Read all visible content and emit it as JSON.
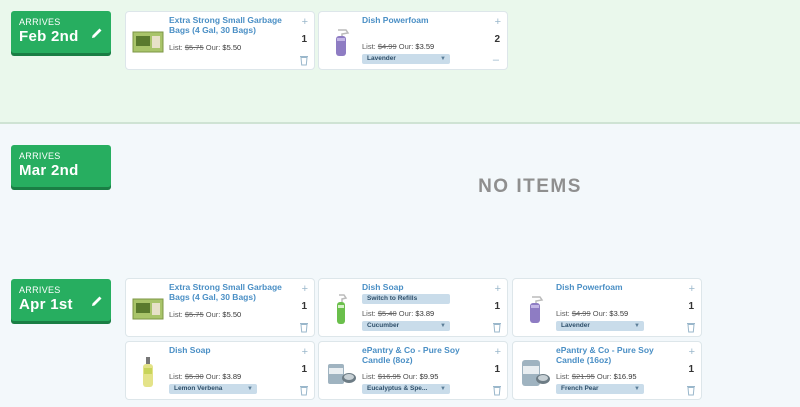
{
  "shipments": [
    {
      "arrives_label": "ARRIVES",
      "date": "Feb 2nd",
      "items": [
        {
          "title": "Extra Strong Small Garbage Bags (4 Gal, 30 Bags)",
          "list_label": "List:",
          "list_price": "$5.75",
          "our_label": "Our:",
          "our_price": "$5.50",
          "qty": "1",
          "variant": "",
          "control": "trash",
          "icon": "garbage-bags-product-image"
        },
        {
          "title": "Dish Powerfoam",
          "list_label": "List:",
          "list_price": "$4.99",
          "our_label": "Our:",
          "our_price": "$3.59",
          "qty": "2",
          "variant": "Lavender",
          "control": "minus",
          "icon": "dish-powerfoam-product-image"
        }
      ]
    },
    {
      "arrives_label": "ARRIVES",
      "date": "Mar 2nd",
      "empty_text": "NO ITEMS",
      "items": []
    },
    {
      "arrives_label": "ARRIVES",
      "date": "Apr 1st",
      "items": [
        {
          "title": "Extra Strong Small Garbage Bags (4 Gal, 30 Bags)",
          "list_label": "List:",
          "list_price": "$5.75",
          "our_label": "Our:",
          "our_price": "$5.50",
          "qty": "1",
          "variant": "",
          "control": "trash",
          "icon": "garbage-bags-product-image"
        },
        {
          "title": "Dish Soap",
          "refill_label": "Switch to Refills",
          "list_label": "List:",
          "list_price": "$5.40",
          "our_label": "Our:",
          "our_price": "$3.89",
          "qty": "1",
          "variant": "Cucumber",
          "control": "trash",
          "icon": "dish-soap-cucumber-product-image"
        },
        {
          "title": "Dish Powerfoam",
          "list_label": "List:",
          "list_price": "$4.99",
          "our_label": "Our:",
          "our_price": "$3.59",
          "qty": "1",
          "variant": "Lavender",
          "control": "trash",
          "icon": "dish-powerfoam-product-image"
        },
        {
          "title": "Dish Soap",
          "list_label": "List:",
          "list_price": "$5.30",
          "our_label": "Our:",
          "our_price": "$3.89",
          "qty": "1",
          "variant": "Lemon Verbena",
          "control": "trash",
          "icon": "dish-soap-lemon-product-image"
        },
        {
          "title": "ePantry & Co - Pure Soy Candle (8oz)",
          "list_label": "List:",
          "list_price": "$16.95",
          "our_label": "Our:",
          "our_price": "$9.95",
          "qty": "1",
          "variant": "Eucalyptus & Spe...",
          "control": "trash",
          "icon": "soy-candle-8oz-product-image"
        },
        {
          "title": "ePantry & Co - Pure Soy Candle (16oz)",
          "list_label": "List:",
          "list_price": "$21.95",
          "our_label": "Our:",
          "our_price": "$16.95",
          "qty": "1",
          "variant": "French Pear",
          "control": "trash",
          "icon": "soy-candle-16oz-product-image"
        }
      ]
    }
  ],
  "colors": {
    "badge_green": "#27ae60",
    "link_blue": "#4a8fc5",
    "top_section_bg": "#eaf8ec"
  }
}
